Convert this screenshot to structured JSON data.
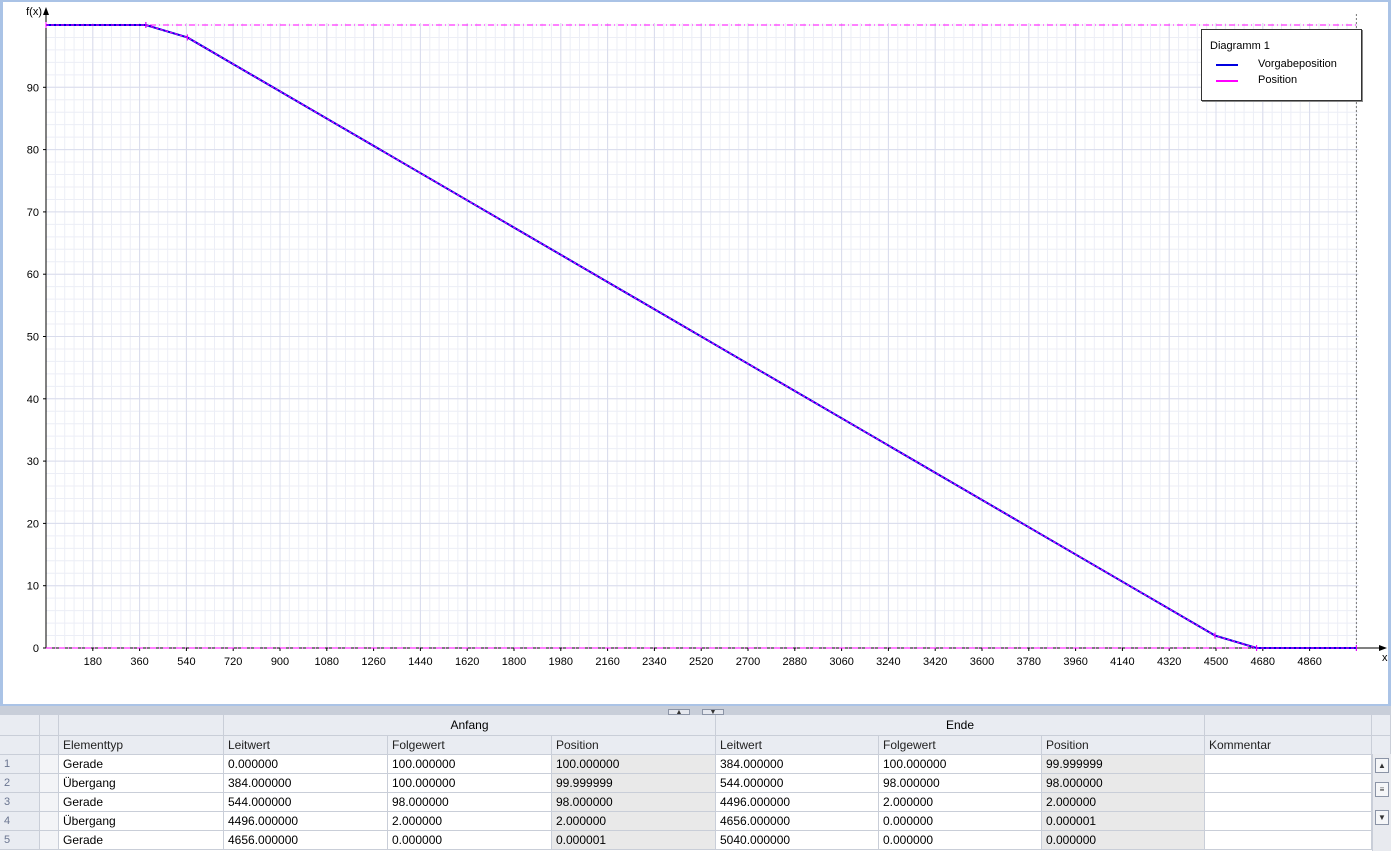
{
  "chart_data": {
    "type": "line",
    "xlabel": "x",
    "ylabel": "f(x)",
    "xlim": [
      0,
      5040
    ],
    "ylim": [
      0,
      100
    ],
    "x_ticks": [
      180,
      360,
      540,
      720,
      900,
      1080,
      1260,
      1440,
      1620,
      1800,
      1980,
      2160,
      2340,
      2520,
      2700,
      2880,
      3060,
      3240,
      3420,
      3600,
      3780,
      3960,
      4140,
      4320,
      4500,
      4680,
      4860
    ],
    "y_ticks": [
      0,
      10,
      20,
      30,
      40,
      50,
      60,
      70,
      80,
      90
    ],
    "grid": true,
    "legend_position": "top-right",
    "legend_title": "Diagramm 1",
    "series": [
      {
        "name": "Vorgabeposition",
        "color": "#0000e0",
        "x": [
          0,
          384,
          544,
          4496,
          4656,
          5040
        ],
        "y": [
          100,
          100,
          98,
          2,
          0,
          0
        ]
      },
      {
        "name": "Position",
        "color": "#ff00ff",
        "x": [
          0,
          384,
          544,
          4496,
          4656,
          5040
        ],
        "y": [
          100,
          100,
          98,
          2,
          0,
          0
        ]
      }
    ]
  },
  "table": {
    "group_headers": [
      "Anfang",
      "Ende"
    ],
    "columns": [
      "Elementtyp",
      "Leitwert",
      "Folgewert",
      "Position",
      "Leitwert",
      "Folgewert",
      "Position",
      "Kommentar"
    ],
    "rows": [
      {
        "num": "1",
        "type": "Gerade",
        "a_leit": "0.000000",
        "a_folge": "100.000000",
        "a_pos": "100.000000",
        "e_leit": "384.000000",
        "e_folge": "100.000000",
        "e_pos": "99.999999",
        "comment": ""
      },
      {
        "num": "2",
        "type": "Übergang",
        "a_leit": "384.000000",
        "a_folge": "100.000000",
        "a_pos": "99.999999",
        "e_leit": "544.000000",
        "e_folge": "98.000000",
        "e_pos": "98.000000",
        "comment": ""
      },
      {
        "num": "3",
        "type": "Gerade",
        "a_leit": "544.000000",
        "a_folge": "98.000000",
        "a_pos": "98.000000",
        "e_leit": "4496.000000",
        "e_folge": "2.000000",
        "e_pos": "2.000000",
        "comment": ""
      },
      {
        "num": "4",
        "type": "Übergang",
        "a_leit": "4496.000000",
        "a_folge": "2.000000",
        "a_pos": "2.000000",
        "e_leit": "4656.000000",
        "e_folge": "0.000000",
        "e_pos": "0.000001",
        "comment": ""
      },
      {
        "num": "5",
        "type": "Gerade",
        "a_leit": "4656.000000",
        "a_folge": "0.000000",
        "a_pos": "0.000001",
        "e_leit": "5040.000000",
        "e_folge": "0.000000",
        "e_pos": "0.000000",
        "comment": ""
      }
    ]
  }
}
